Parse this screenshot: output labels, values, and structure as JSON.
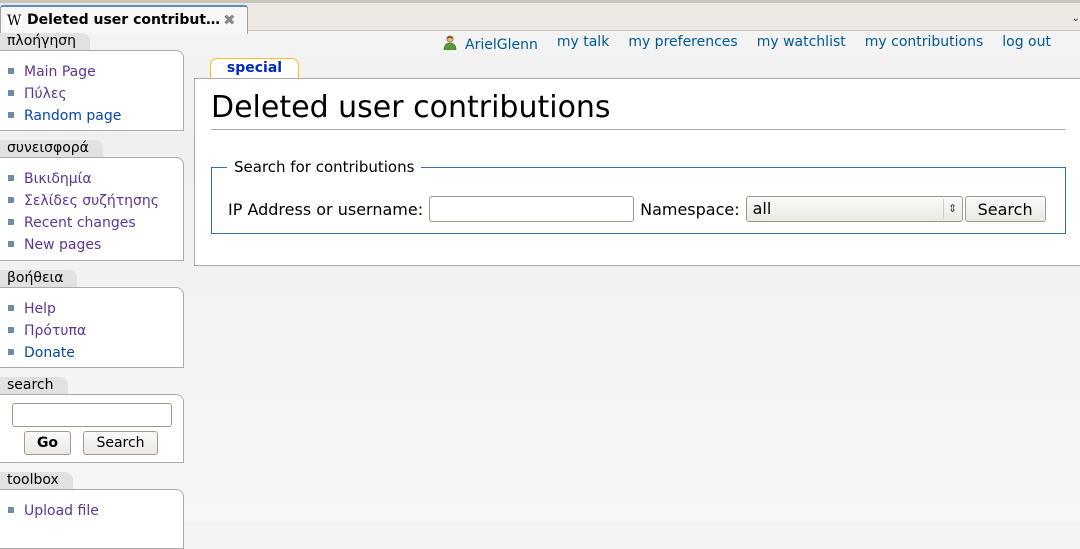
{
  "browser": {
    "tab_icon": "W",
    "tab_title": "Deleted user contribut…",
    "tab_close": "✖",
    "tab_menu": "⌄"
  },
  "personal": {
    "user_icon": "user-icon",
    "links": [
      {
        "label": "ArielGlenn"
      },
      {
        "label": "my talk"
      },
      {
        "label": "my preferences"
      },
      {
        "label": "my watchlist"
      },
      {
        "label": "my contributions"
      },
      {
        "label": "log out"
      }
    ]
  },
  "sidebar": {
    "navigation": {
      "title": "πλοήγηση",
      "items": [
        {
          "label": "Main Page",
          "visited": true
        },
        {
          "label": "Πύλες",
          "visited": true
        },
        {
          "label": "Random page",
          "visited": false
        }
      ]
    },
    "contribute": {
      "title": "συνεισφορά",
      "items": [
        {
          "label": "Βικιδημία",
          "visited": true
        },
        {
          "label": "Σελίδες συζήτησης",
          "visited": true
        },
        {
          "label": "Recent changes",
          "visited": true
        },
        {
          "label": "New pages",
          "visited": true
        }
      ]
    },
    "help": {
      "title": "βοήθεια",
      "items": [
        {
          "label": "Help",
          "visited": true
        },
        {
          "label": "Πρότυπα",
          "visited": true
        },
        {
          "label": "Donate",
          "visited": false
        }
      ]
    },
    "search": {
      "title": "search",
      "input_value": "",
      "go_label": "Go",
      "search_label": "Search"
    },
    "toolbox": {
      "title": "toolbox",
      "items": [
        {
          "label": "Upload file",
          "visited": true
        }
      ]
    }
  },
  "content": {
    "tab_label": "special",
    "title": "Deleted user contributions",
    "form": {
      "legend": "Search for contributions",
      "ip_label": "IP Address or username:",
      "ip_value": "",
      "namespace_label": "Namespace:",
      "namespace_selected": "all",
      "submit_label": "Search"
    }
  },
  "colors": {
    "link": "#0645ad",
    "visited_link": "#5a3696",
    "personal_link": "#005896",
    "fieldset_border": "#2f6fab",
    "tab_accent": "#fabd23"
  }
}
